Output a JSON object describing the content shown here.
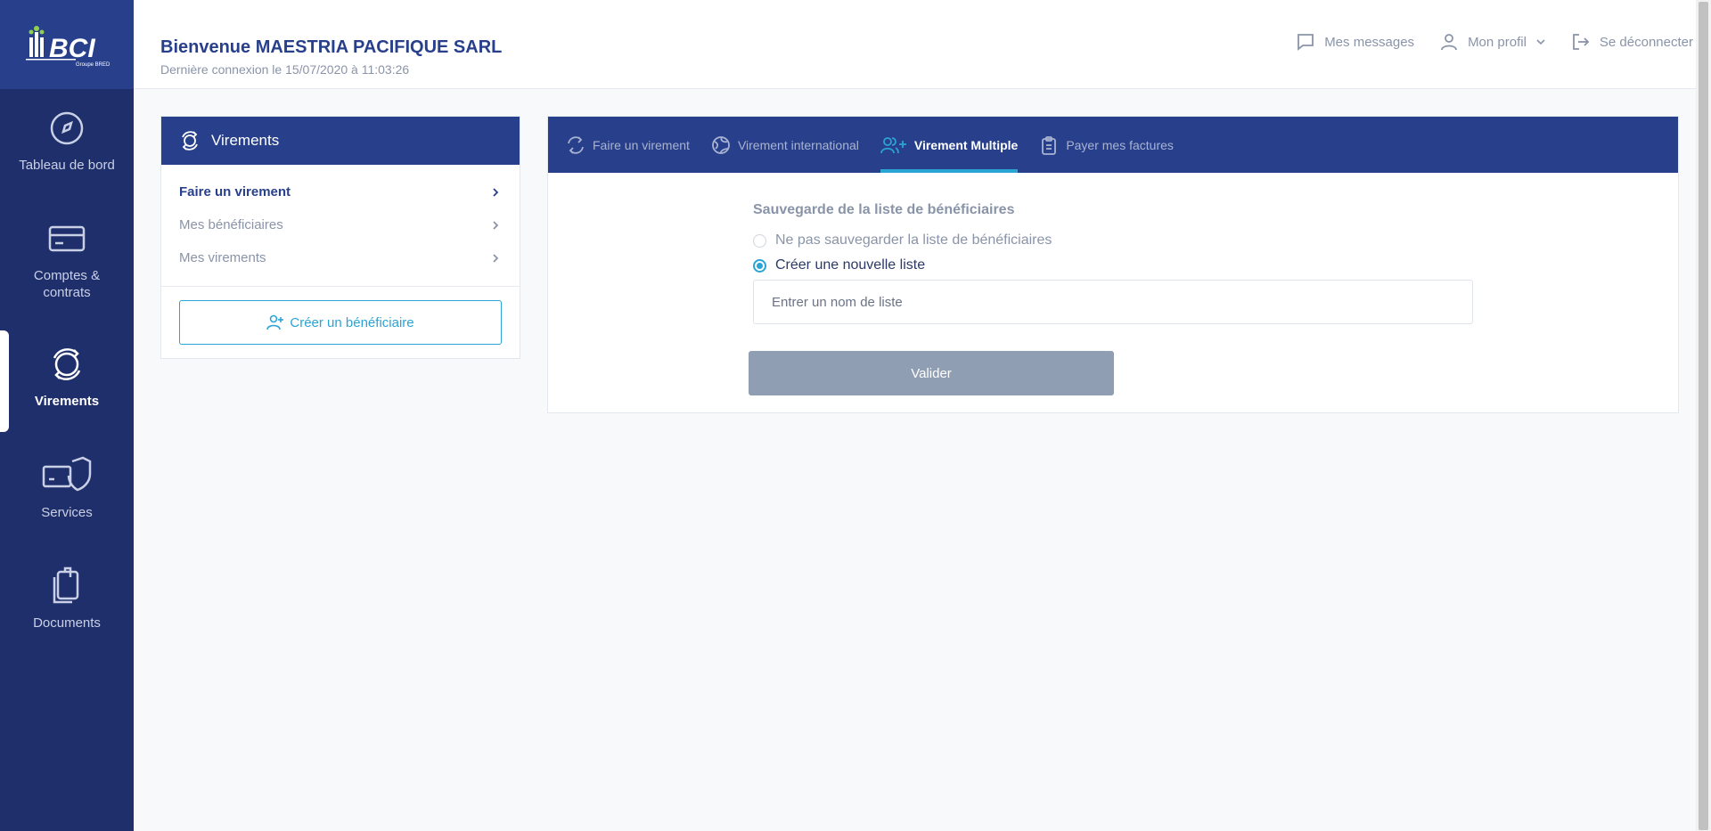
{
  "sidebar": {
    "logo_text": "BCI",
    "logo_sub": "Groupe BRED",
    "items": [
      {
        "label": "Tableau de bord",
        "icon": "dashboard-icon"
      },
      {
        "label": "Comptes & contrats",
        "icon": "card-icon"
      },
      {
        "label": "Virements",
        "icon": "transfer-icon",
        "active": true
      },
      {
        "label": "Services",
        "icon": "shield-icon"
      },
      {
        "label": "Documents",
        "icon": "documents-icon"
      }
    ]
  },
  "header": {
    "welcome": "Bienvenue MAESTRIA PACIFIQUE SARL",
    "last_login": "Dernière connexion le 15/07/2020 à 11:03:26",
    "messages": "Mes messages",
    "profile": "Mon profil",
    "logout": "Se déconnecter"
  },
  "left_panel": {
    "title": "Virements",
    "items": [
      {
        "label": "Faire un virement",
        "active": true
      },
      {
        "label": "Mes bénéficiaires"
      },
      {
        "label": "Mes virements"
      }
    ],
    "create_button": "Créer un bénéficiaire"
  },
  "main": {
    "tabs": [
      {
        "label": "Faire un virement",
        "icon": "transfer-icon"
      },
      {
        "label": "Virement international",
        "icon": "globe-icon"
      },
      {
        "label": "Virement Multiple",
        "icon": "users-add-icon",
        "active": true
      },
      {
        "label": "Payer mes factures",
        "icon": "clipboard-icon"
      }
    ],
    "form_title": "Sauvegarde de la liste de bénéficiaires",
    "options": [
      {
        "label": "Ne pas sauvegarder la liste de bénéficiaires",
        "checked": false
      },
      {
        "label": "Créer une nouvelle liste",
        "checked": true
      }
    ],
    "list_name_placeholder": "Entrer un nom de liste",
    "submit_label": "Valider"
  },
  "colors": {
    "primary": "#28408b",
    "sidebar": "#1f2f6b",
    "accent": "#2aa4d5",
    "muted": "#8a94a8"
  }
}
